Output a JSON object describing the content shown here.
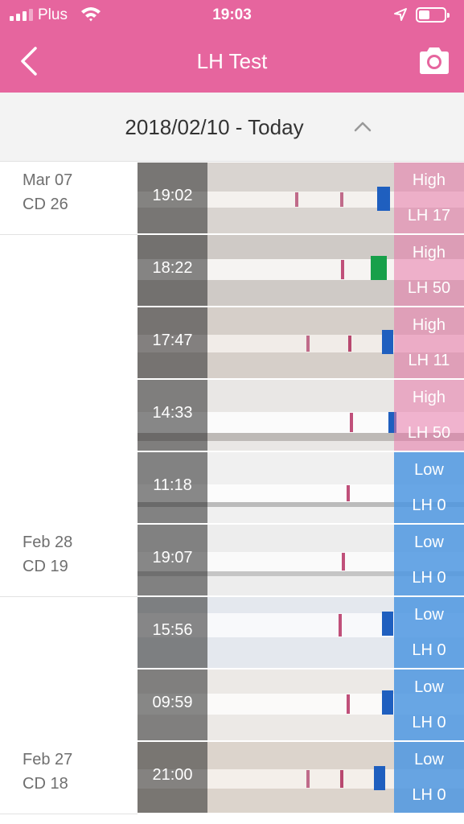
{
  "status_bar": {
    "carrier": "Plus",
    "time": "19:03"
  },
  "nav": {
    "title": "LH Test",
    "back_icon": "chevron-left-icon",
    "camera_icon": "camera-icon"
  },
  "range": {
    "label": "2018/02/10 - Today",
    "icon": "chevron-up-icon"
  },
  "days": [
    {
      "date": "Mar 07",
      "cycle_day": "CD 26"
    },
    {
      "date": "Feb 28",
      "cycle_day": "CD 19"
    },
    {
      "date": "Feb 27",
      "cycle_day": "CD 18"
    }
  ],
  "entries": [
    {
      "time": "19:02",
      "level": "High",
      "value": "LH 17"
    },
    {
      "time": "18:22",
      "level": "High",
      "value": "LH 50"
    },
    {
      "time": "17:47",
      "level": "High",
      "value": "LH 11"
    },
    {
      "time": "14:33",
      "level": "High",
      "value": "LH 50"
    },
    {
      "time": "11:18",
      "level": "Low",
      "value": "LH 0"
    },
    {
      "time": "19:07",
      "level": "Low",
      "value": "LH 0"
    },
    {
      "time": "15:56",
      "level": "Low",
      "value": "LH 0"
    },
    {
      "time": "09:59",
      "level": "Low",
      "value": "LH 0"
    },
    {
      "time": "21:00",
      "level": "Low",
      "value": "LH 0"
    }
  ],
  "colors": {
    "accent": "#e6659e",
    "high": "#e878aa",
    "low": "#4d96e1"
  }
}
